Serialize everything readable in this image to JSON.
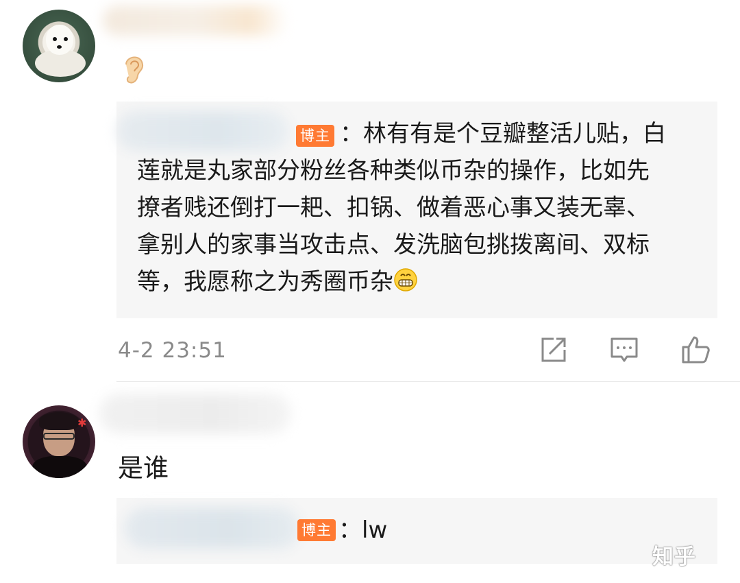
{
  "comment1": {
    "reply": {
      "badge": "博主",
      "first_line": "：林有有是个豆瓣整活儿贴，白",
      "text": "莲就是丸家部分粉丝各种类似币杂的操作，比如先\n撩者贱还倒打一耙、扣锅、做着恶心事又装无辜、\n拿别人的家事当攻击点、发洗脑包挑拨离间、双标\n等，我愿称之为秀圈币杂",
      "emoji": "grin-icon"
    },
    "timestamp": "4-2 23:51",
    "actions": [
      "share-icon",
      "comment-icon",
      "like-icon"
    ]
  },
  "comment2": {
    "text": "是谁",
    "reply": {
      "badge": "博主",
      "text": "：lw"
    }
  },
  "watermark": "知乎"
}
